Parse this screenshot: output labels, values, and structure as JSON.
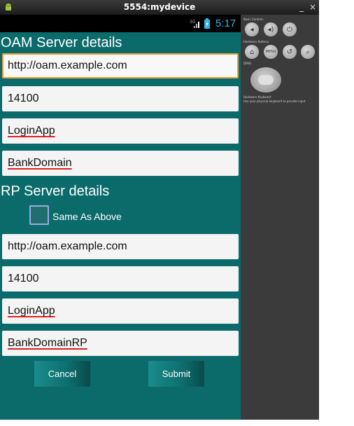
{
  "window": {
    "title": "5554:mydevice",
    "minimize": "_",
    "close": "×"
  },
  "statusbar": {
    "network": "3G",
    "time": "5:17"
  },
  "oam": {
    "heading": "OAM Server details",
    "url": "http://oam.example.com",
    "port": "14100",
    "app": "LoginApp",
    "domain": "BankDomain"
  },
  "rp": {
    "heading": "RP Server details",
    "same_as_above": "Same As Above",
    "same_as_above_checked": false,
    "url": "http://oam.example.com",
    "port": "14100",
    "app": "LoginApp",
    "domain": "BankDomainRP"
  },
  "buttons": {
    "cancel": "Cancel",
    "submit": "Submit"
  },
  "emulator_panel": {
    "basic_controls": "Basic Controls",
    "hardware_buttons": "Hardware Buttons",
    "dpad": "DPAD",
    "keyboard": "Hardware Keyboard",
    "keyboard_hint": "Use your physical keyboard to provide input",
    "menu_label": "MENU"
  },
  "colors": {
    "screen_bg": "#0b6b6b",
    "focus": "#f0a030",
    "clock": "#33b5e5"
  }
}
